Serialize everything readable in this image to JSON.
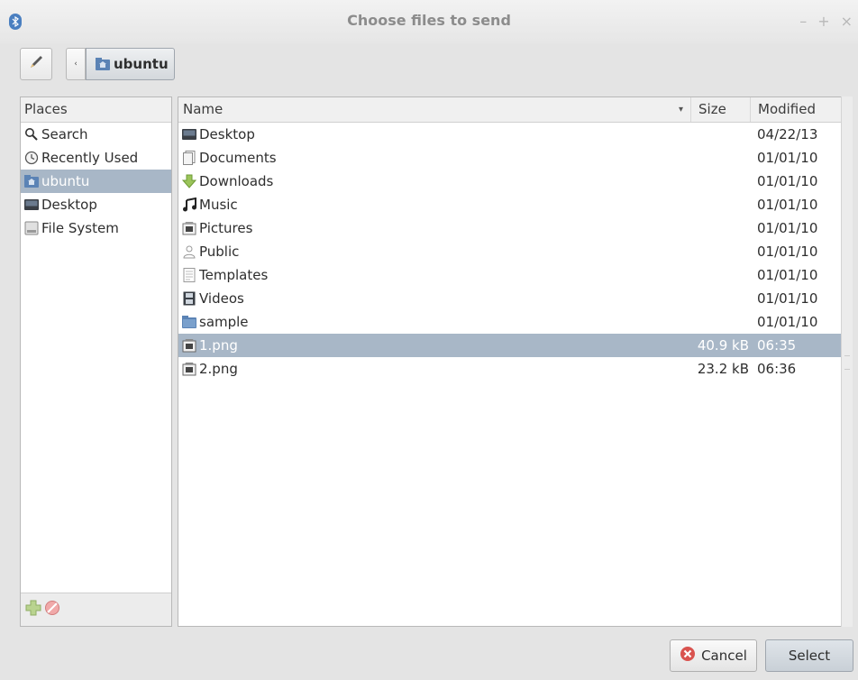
{
  "window": {
    "title": "Choose files to send",
    "controls": [
      "–",
      "+",
      "×"
    ]
  },
  "toolbar": {
    "back_glyph": "‹",
    "current_folder": "ubuntu"
  },
  "places": {
    "header": "Places",
    "items": [
      {
        "label": "Search",
        "icon": "search-icon"
      },
      {
        "label": "Recently Used",
        "icon": "clock-icon"
      },
      {
        "label": "ubuntu",
        "icon": "home-folder-icon",
        "selected": true
      },
      {
        "label": "Desktop",
        "icon": "desktop-icon"
      },
      {
        "label": "File System",
        "icon": "drive-icon"
      }
    ]
  },
  "files": {
    "columns": {
      "name": "Name",
      "size": "Size",
      "modified": "Modified"
    },
    "rows": [
      {
        "name": "Desktop",
        "size": "",
        "modified": "04/22/13",
        "icon": "desktop-icon"
      },
      {
        "name": "Documents",
        "size": "",
        "modified": "01/01/10",
        "icon": "documents-icon"
      },
      {
        "name": "Downloads",
        "size": "",
        "modified": "01/01/10",
        "icon": "downloads-icon"
      },
      {
        "name": "Music",
        "size": "",
        "modified": "01/01/10",
        "icon": "music-icon"
      },
      {
        "name": "Pictures",
        "size": "",
        "modified": "01/01/10",
        "icon": "pictures-icon"
      },
      {
        "name": "Public",
        "size": "",
        "modified": "01/01/10",
        "icon": "public-icon"
      },
      {
        "name": "Templates",
        "size": "",
        "modified": "01/01/10",
        "icon": "templates-icon"
      },
      {
        "name": "Videos",
        "size": "",
        "modified": "01/01/10",
        "icon": "videos-icon"
      },
      {
        "name": "sample",
        "size": "",
        "modified": "01/01/10",
        "icon": "folder-icon"
      },
      {
        "name": "1.png",
        "size": "40.9 kB",
        "modified": "06:35",
        "icon": "image-file-icon",
        "selected": true
      },
      {
        "name": "2.png",
        "size": "23.2 kB",
        "modified": "06:36",
        "icon": "image-file-icon"
      }
    ]
  },
  "buttons": {
    "cancel": "Cancel",
    "select": "Select"
  },
  "colors": {
    "selection": "#a8b7c7",
    "cancel_icon": "#d9534f",
    "downloads_arrow": "#e3b200"
  }
}
